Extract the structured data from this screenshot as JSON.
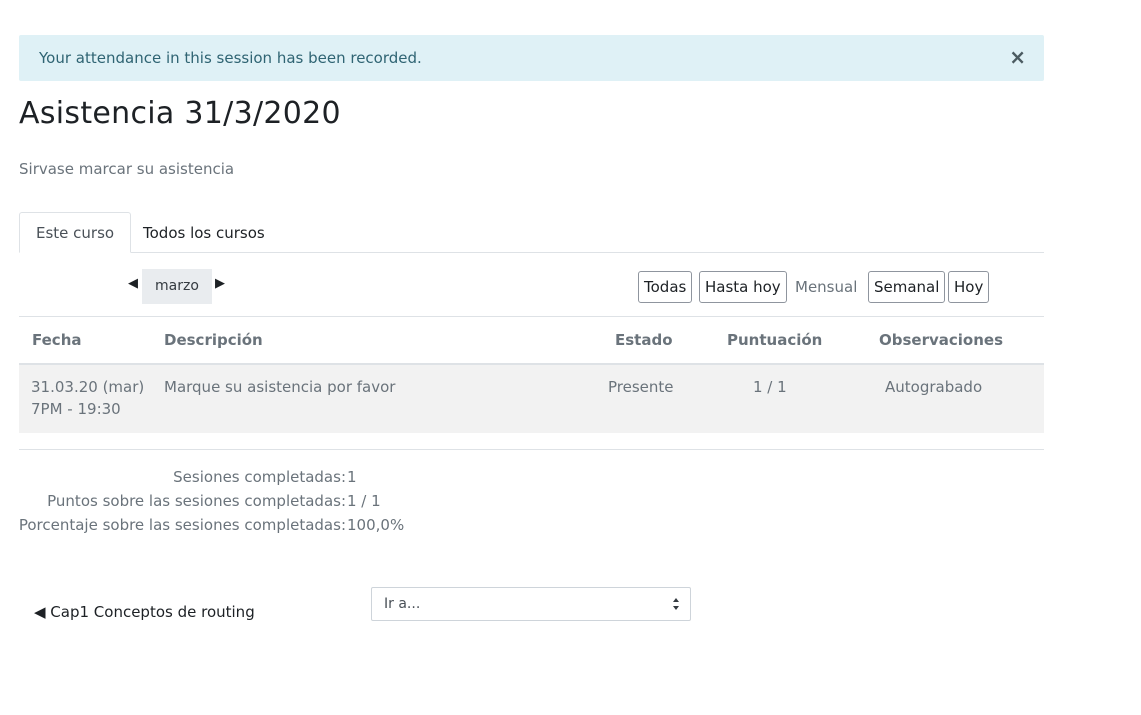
{
  "alert": {
    "message": "Your attendance in this session has been recorded.",
    "close_glyph": "×"
  },
  "page": {
    "title": "Asistencia 31/3/2020",
    "intro": "Sirvase marcar su asistencia"
  },
  "tabs": [
    {
      "label": "Este curso",
      "active": true
    },
    {
      "label": "Todos los cursos",
      "active": false
    }
  ],
  "calendar": {
    "month": "marzo",
    "prev_glyph": "◀",
    "next_glyph": "▶"
  },
  "views": {
    "all": "Todas",
    "until_today": "Hasta hoy",
    "monthly": "Mensual",
    "weekly": "Semanal",
    "today": "Hoy",
    "selected": "Mensual"
  },
  "table": {
    "headers": [
      "Fecha",
      "Descripción",
      "Estado",
      "Puntuación",
      "Observaciones"
    ],
    "rows": [
      {
        "date": "31.03.20 (mar)",
        "time": "7PM - 19:30",
        "description": "Marque su asistencia por favor",
        "status": "Presente",
        "score": "1 / 1",
        "remarks": "Autograbado"
      }
    ]
  },
  "summary": [
    {
      "label": "Sesiones completadas:",
      "value": "1"
    },
    {
      "label": "Puntos sobre las sesiones completadas:",
      "value": "1 / 1"
    },
    {
      "label": "Porcentaje sobre las sesiones completadas:",
      "value": "100,0%"
    }
  ],
  "footer": {
    "prev_activity": "◀ Cap1 Conceptos de routing",
    "jump_placeholder": "Ir a..."
  },
  "colors": {
    "alert_bg": "#dff1f6",
    "alert_text": "#2f6473",
    "row_bg": "#f2f2f2"
  }
}
